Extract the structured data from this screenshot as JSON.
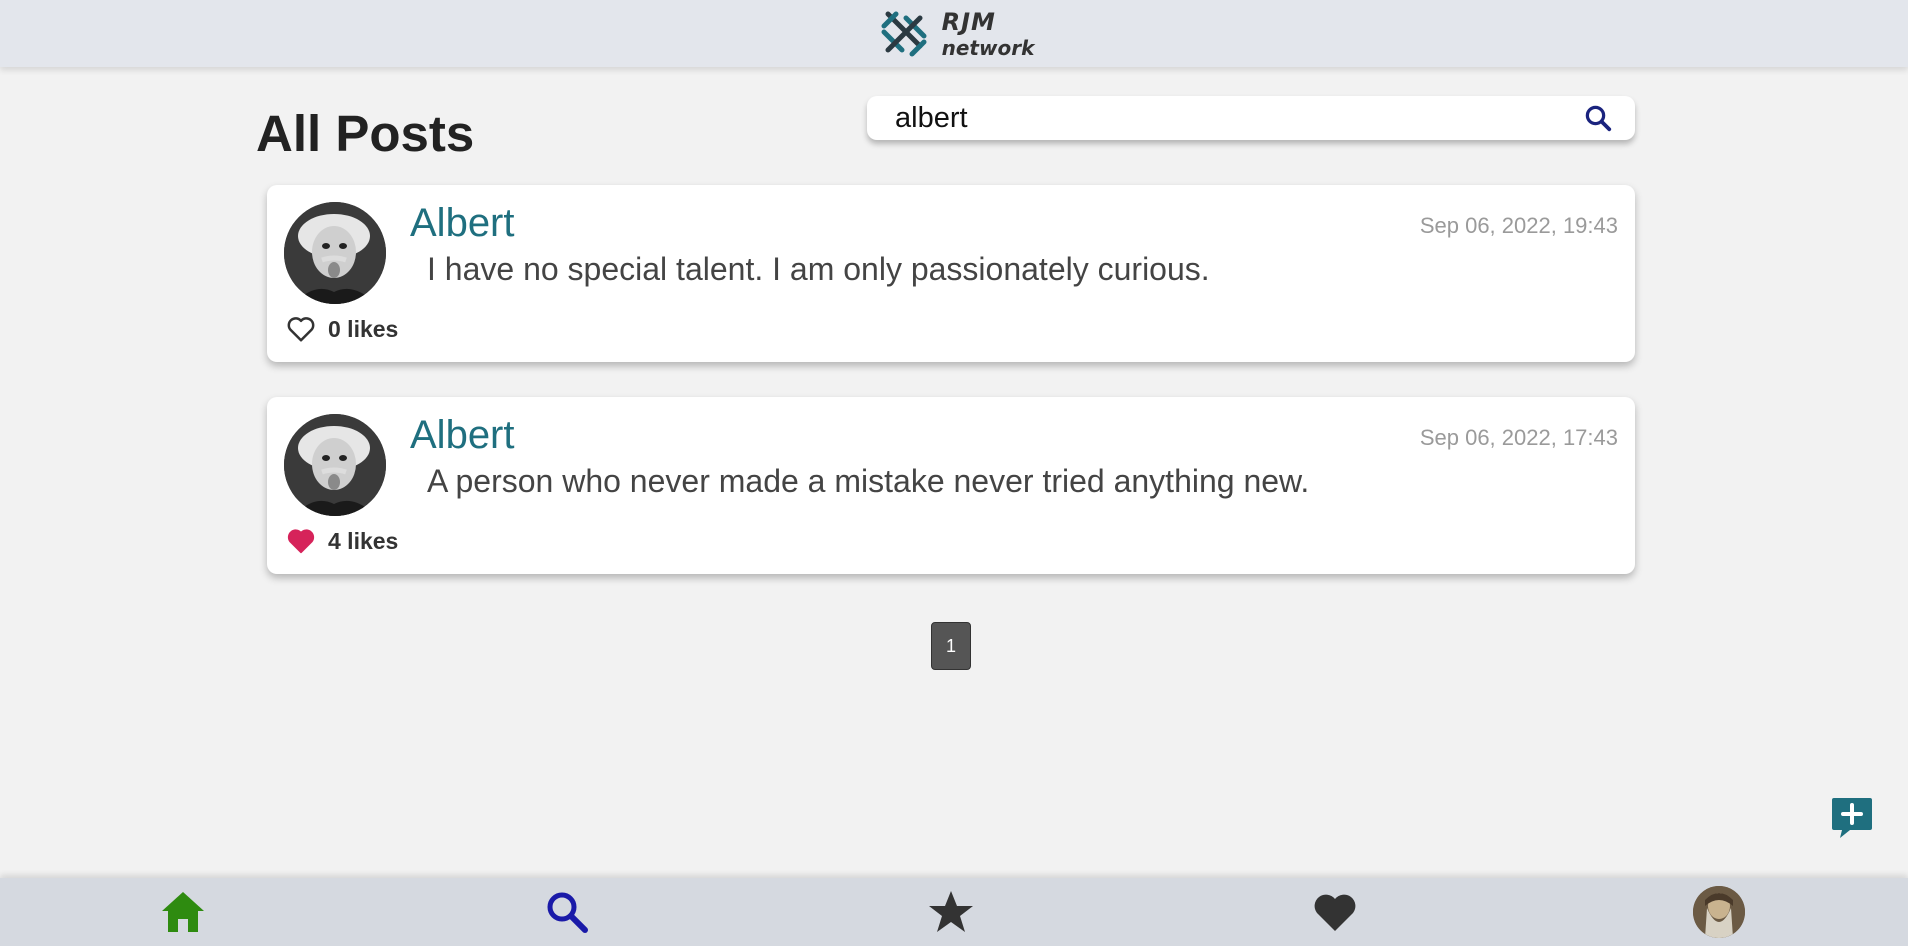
{
  "header": {
    "logo_line1": "RJM",
    "logo_line2": "network",
    "logo_icon": "rjm-knot-logo"
  },
  "main": {
    "title": "All Posts",
    "search": {
      "value": "albert",
      "icon": "search-icon"
    }
  },
  "posts": [
    {
      "author": "Albert",
      "timestamp": "Sep 06, 2022, 19:43",
      "text": "I have no special talent. I am only passionately curious.",
      "likes_label": "0 likes",
      "liked": false
    },
    {
      "author": "Albert",
      "timestamp": "Sep 06, 2022, 17:43",
      "text": "A person who never made a mistake never tried anything new.",
      "likes_label": "4 likes",
      "liked": true
    }
  ],
  "pagination": {
    "current": "1"
  },
  "fab": {
    "icon": "new-post-icon"
  },
  "bottom_nav": {
    "items": [
      {
        "name": "home",
        "icon": "home-icon",
        "color": "#2e8b10"
      },
      {
        "name": "search",
        "icon": "search-icon",
        "color": "#1a1aa8"
      },
      {
        "name": "favorites",
        "icon": "star-icon",
        "color": "#333333"
      },
      {
        "name": "liked",
        "icon": "heart-icon",
        "color": "#333333"
      },
      {
        "name": "profile",
        "icon": "profile-avatar"
      }
    ]
  },
  "colors": {
    "accent": "#1f6f7f",
    "liked_heart": "#d6235a",
    "header_bg": "#e3e6ec",
    "page_bg": "#f2f2f2"
  }
}
